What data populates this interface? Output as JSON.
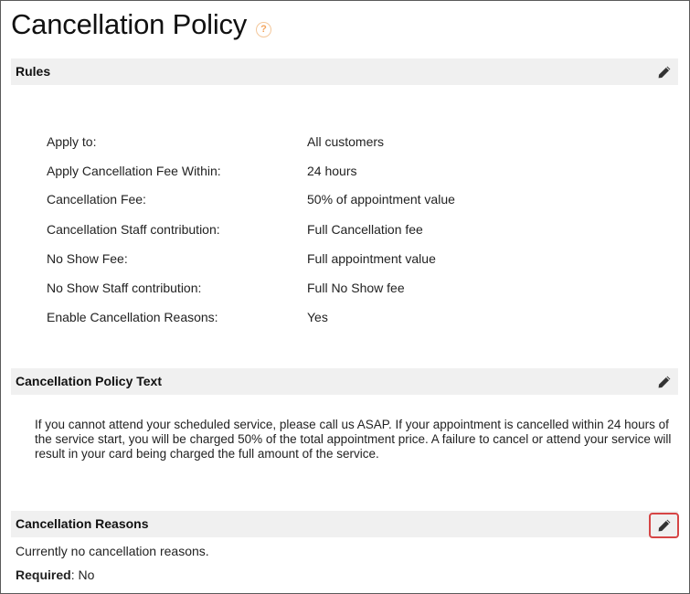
{
  "page": {
    "title": "Cancellation Policy",
    "help_icon": "?"
  },
  "rules": {
    "header": "Rules",
    "edit_icon": "pencil-icon",
    "items": [
      {
        "label": "Apply to:",
        "value": "All customers"
      },
      {
        "label": "Apply Cancellation Fee Within:",
        "value": "24 hours"
      },
      {
        "label": "Cancellation Fee:",
        "value": "50% of appointment value"
      },
      {
        "label": "Cancellation Staff contribution:",
        "value": "Full Cancellation fee"
      },
      {
        "label": "No Show Fee:",
        "value": "Full appointment value"
      },
      {
        "label": "No Show Staff contribution:",
        "value": "Full No Show fee"
      },
      {
        "label": "Enable Cancellation Reasons:",
        "value": "Yes"
      }
    ]
  },
  "policy_text": {
    "header": "Cancellation Policy Text",
    "body": "If you cannot attend your scheduled service, please call us ASAP. If your appointment is cancelled within 24 hours of the service start, you will be charged 50% of the total appointment price. A failure to cancel or attend your service will result in your card being charged the full amount of the service."
  },
  "reasons": {
    "header": "Cancellation Reasons",
    "empty_text": "Currently no cancellation reasons.",
    "required_label": "Required",
    "required_value": ": No",
    "highlight_color": "#d64545"
  }
}
